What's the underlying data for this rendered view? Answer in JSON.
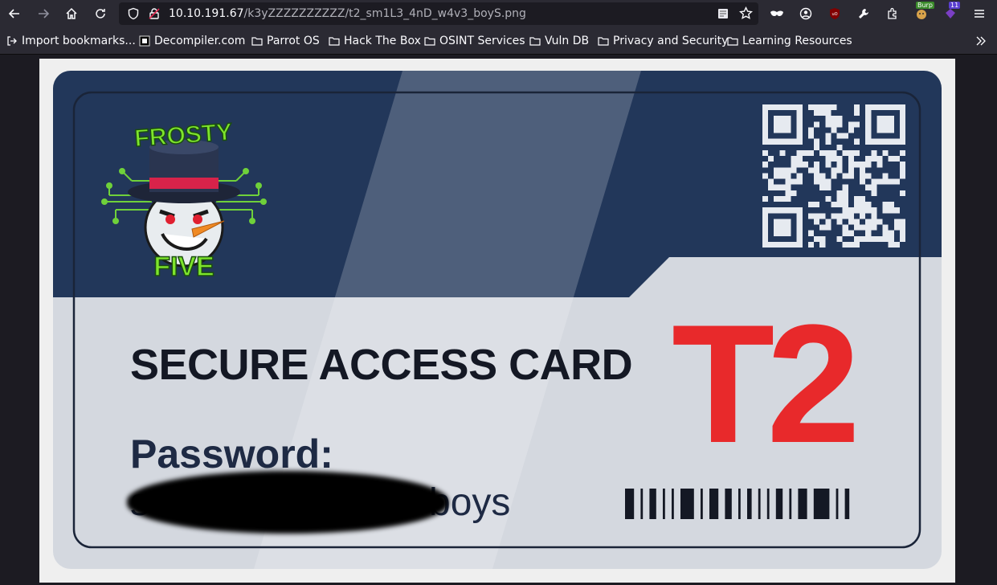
{
  "browser": {
    "url_host": "10.10.191.67",
    "url_path": "/k3yZZZZZZZZZZ/t2_sm1L3_4nD_w4v3_boyS.png",
    "extensions": {
      "burp_badge": "Burp",
      "notification_count": "11"
    }
  },
  "bookmarks": [
    {
      "label": "Import bookmarks...",
      "icon": "import-icon"
    },
    {
      "label": "Decompiler.com",
      "icon": "site-icon"
    },
    {
      "label": "Parrot OS",
      "icon": "folder-icon"
    },
    {
      "label": "Hack The Box",
      "icon": "folder-icon"
    },
    {
      "label": "OSINT Services",
      "icon": "folder-icon"
    },
    {
      "label": "Vuln DB",
      "icon": "folder-icon"
    },
    {
      "label": "Privacy and Security",
      "icon": "folder-icon"
    },
    {
      "label": "Learning Resources",
      "icon": "folder-icon"
    }
  ],
  "card": {
    "logo_top": "FROSTY",
    "logo_bottom": "FIVE",
    "title": "SECURE ACCESS CARD",
    "password_label": "Password:",
    "password_visible": "boys",
    "password_partial": "s",
    "code": "T2"
  },
  "colors": {
    "navy": "#22375a",
    "card_light": "#d4d8df",
    "code_red": "#e8292b",
    "logo_green": "#7ee52c"
  }
}
